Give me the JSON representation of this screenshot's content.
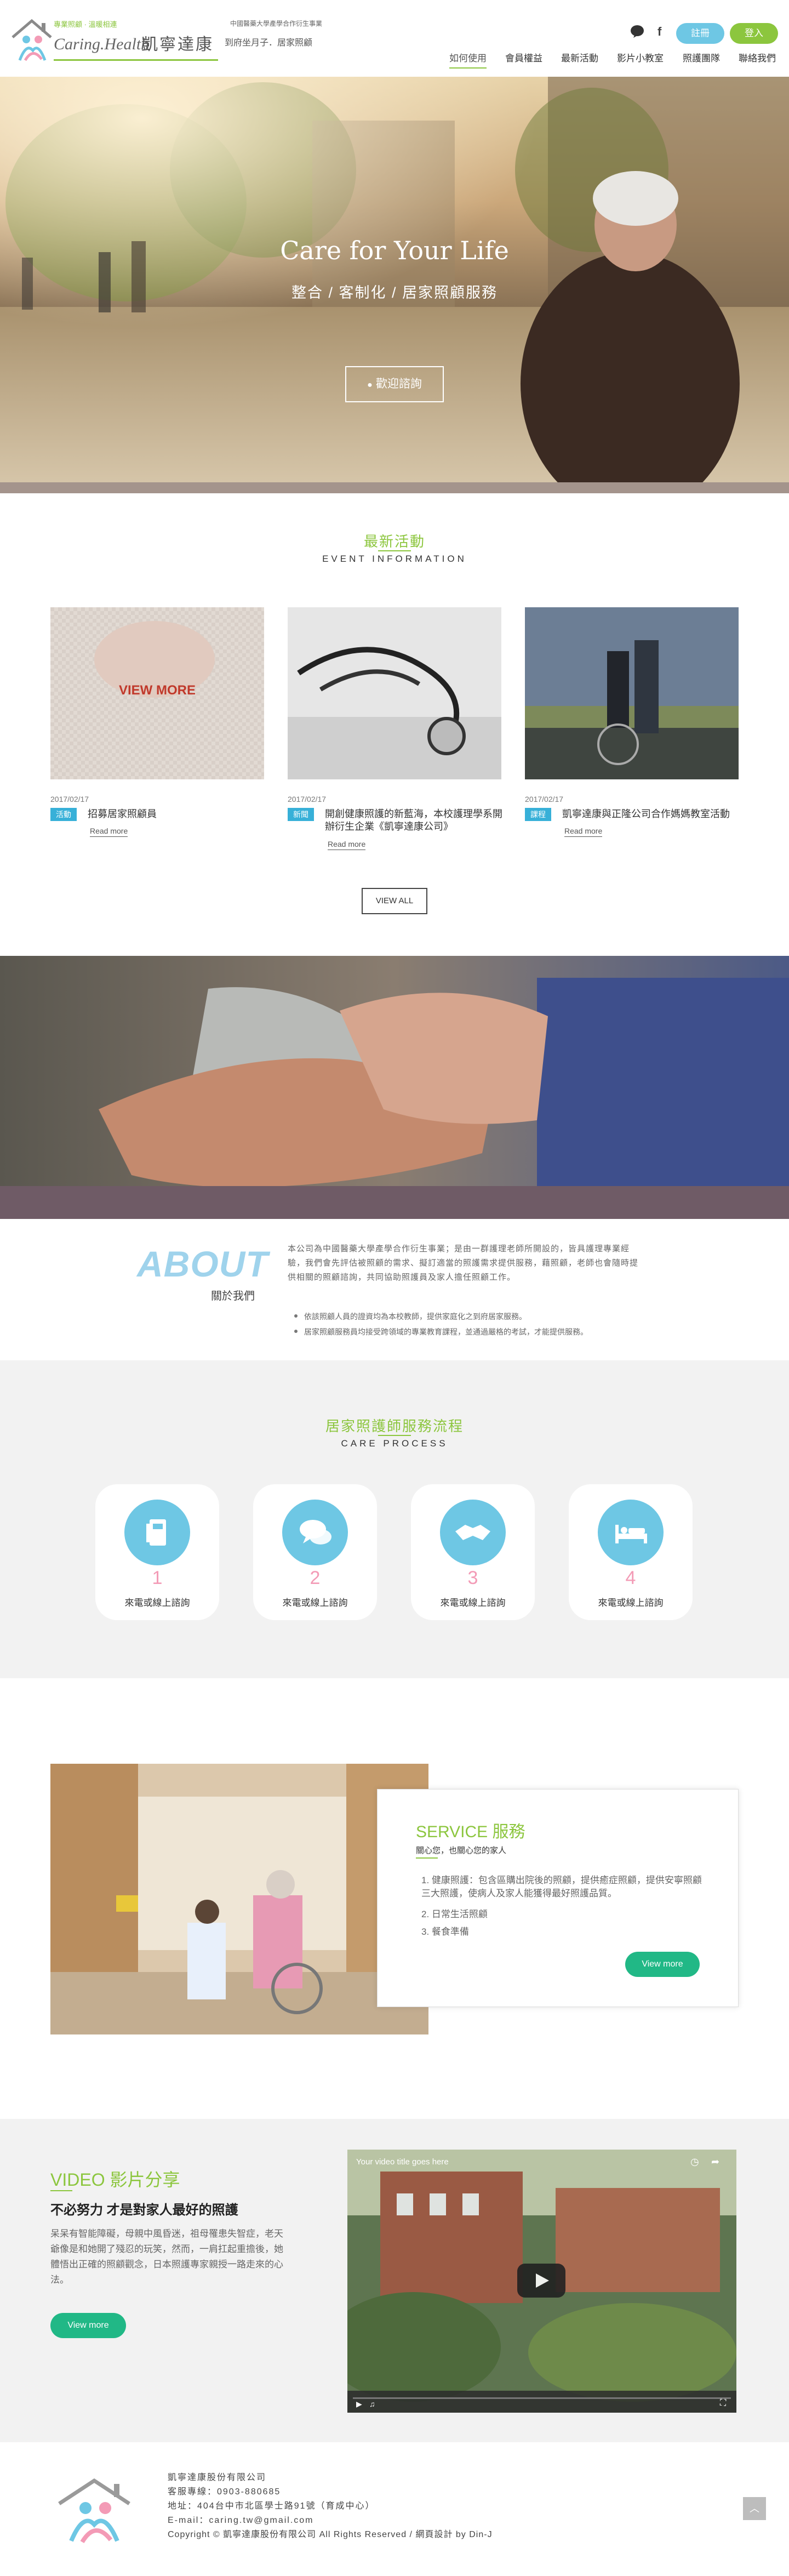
{
  "header": {
    "slogan": "專業照顧 · 溫暖相連",
    "logo_en": "Caring.Health",
    "logo_cn": "凱寧達康",
    "company_desc": "中國醫藥大學產學合作衍生事業",
    "services": "到府坐月子．居家照顧",
    "icons": {
      "line": "line-icon",
      "facebook": "facebook-icon"
    },
    "buttons": {
      "register": "註冊",
      "login": "登入"
    },
    "nav": [
      "如何使用",
      "會員權益",
      "最新活動",
      "影片小教室",
      "照護團隊",
      "聯絡我們"
    ]
  },
  "hero": {
    "title": "Care for Your Life",
    "subtitle": "整合 / 客制化 / 居家照顧服務",
    "button": "歡迎諮詢"
  },
  "events": {
    "title_cn": "最新活動",
    "title_en": "EVENT INFORMATION",
    "overlay": "VIEW MORE",
    "items": [
      {
        "date": "2017/02/17",
        "tag": "活動",
        "title": "招募居家照顧員",
        "more": "Read more"
      },
      {
        "date": "2017/02/17",
        "tag": "新聞",
        "title": "開創健康照護的新藍海，本校護理學系開辦衍生企業《凱寧達康公司》",
        "more": "Read more"
      },
      {
        "date": "2017/02/17",
        "tag": "課程",
        "title": "凱寧達康與正隆公司合作媽媽教室活動",
        "more": "Read more"
      }
    ],
    "view_all": "VIEW ALL"
  },
  "about": {
    "title_en": "ABOUT",
    "title_cn": "關於我們",
    "paragraph": "本公司為中國醫藥大學產學合作衍生事業；是由一群護理老師所開設的，皆具護理專業經驗，我們會先評估被照顧的需求、擬訂適當的照護需求提供服務，藉照顧，老師也會隨時提供相關的照顧諮詢，共同協助照護員及家人擔任照顧工作。",
    "bullets": [
      "依該照顧人員的證資均為本校教師，提供家庭化之到府居家服務。",
      "居家照顧服務員均接受跨領域的專業教育課程，並通過嚴格的考試，才能提供服務。"
    ]
  },
  "care": {
    "title_cn": "居家照護師服務流程",
    "title_en": "CARE PROCESS",
    "steps": [
      {
        "num": "1",
        "label": "來電或線上諮詢",
        "icon": "phone-icon"
      },
      {
        "num": "2",
        "label": "來電或線上諮詢",
        "icon": "chat-icon"
      },
      {
        "num": "3",
        "label": "來電或線上諮詢",
        "icon": "handshake-icon"
      },
      {
        "num": "4",
        "label": "來電或線上諮詢",
        "icon": "bed-icon"
      }
    ]
  },
  "service": {
    "title": "SERVICE 服務",
    "subtitle": "關心您，也關心您的家人",
    "items": [
      "1. 健康照護：包含區購出院後的照顧，提供癒症照顧，提供安寧照顧三大照護，使病人及家人能獲得最好照護品質。",
      "2. 日常生活照顧",
      "3. 餐食準備"
    ],
    "button": "View more"
  },
  "video": {
    "title": "VIDEO 影片分享",
    "headline": "不必努力 才是對家人最好的照護",
    "text": "呆呆有智能障礙，母親中風昏迷，祖母罹患失智症，老天爺像是和她開了殘忍的玩笑，然而，一肩扛起重擔後，她體悟出正確的照顧觀念，日本照護專家親授一路走來的心法。",
    "button": "View more",
    "overlay_text": "Your video title goes here"
  },
  "footer": {
    "company": "凱寧達康股份有限公司",
    "phone": "客服專線：0903-880685",
    "address": "地址：404台中市北區學士路91號（育成中心）",
    "email": "E-mail：caring.tw@gmail.com",
    "copyright": "Copyright © 凱寧達康股份有限公司 All Rights Reserved / 網頁設計 by Din-J",
    "to_top": "︿"
  },
  "colors": {
    "accent_green": "#8cc63e",
    "pill_blue": "#6ec7e4",
    "pill_green": "#8cc63e",
    "button_teal": "#21b886",
    "tag_blue": "#37b0d8",
    "number_pink": "#f39bb6"
  }
}
